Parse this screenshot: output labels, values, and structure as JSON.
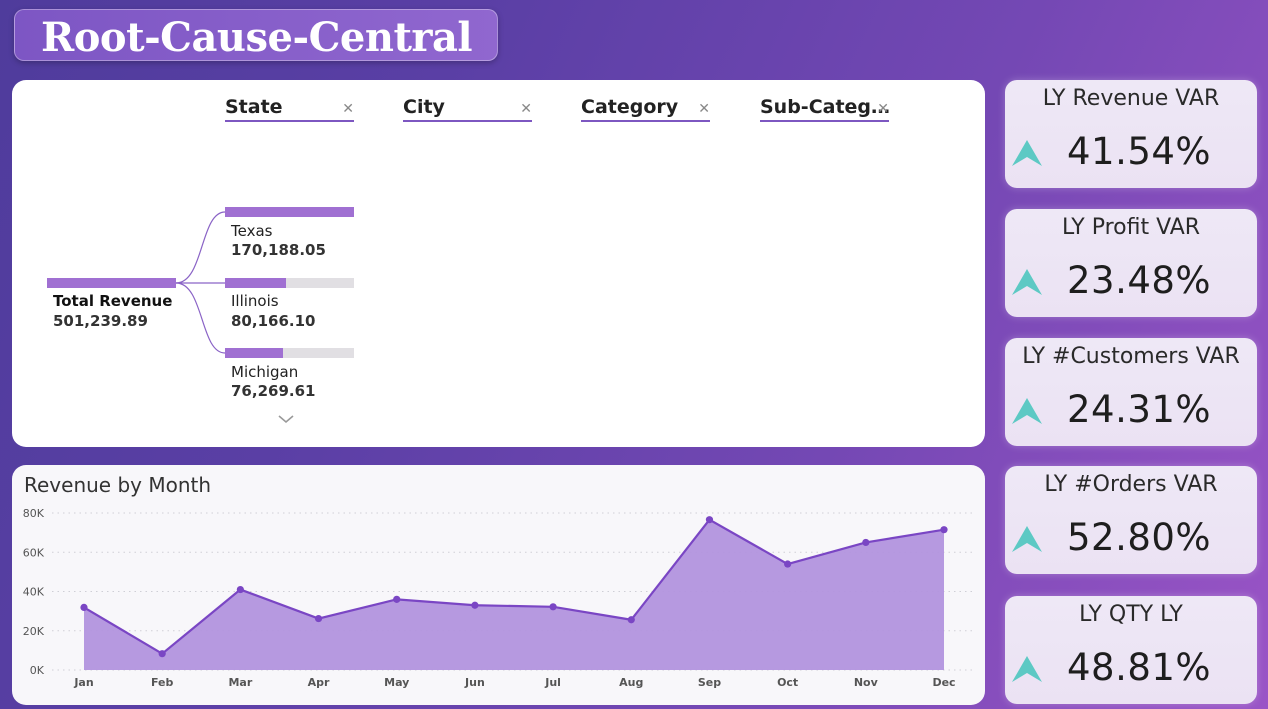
{
  "app_title": "Root-Cause-Central",
  "decomposition": {
    "headers": [
      {
        "label": "State",
        "clear_icon": "close-icon"
      },
      {
        "label": "City",
        "clear_icon": "close-icon"
      },
      {
        "label": "Category",
        "clear_icon": "close-icon"
      },
      {
        "label": "Sub-Categ…",
        "clear_icon": "close-icon"
      }
    ],
    "root": {
      "label": "Total Revenue",
      "value": "501,239.89"
    },
    "nodes": [
      {
        "label": "Texas",
        "value": "170,188.05",
        "fill": 1.0
      },
      {
        "label": "Illinois",
        "value": "80,166.10",
        "fill": 0.47
      },
      {
        "label": "Michigan",
        "value": "76,269.61",
        "fill": 0.45
      }
    ],
    "more_icon": "chevron-down-icon"
  },
  "trend": {
    "title": "Revenue by Month"
  },
  "chart_data": {
    "type": "area",
    "title": "Revenue by Month",
    "xlabel": "",
    "ylabel": "",
    "categories": [
      "Jan",
      "Feb",
      "Mar",
      "Apr",
      "May",
      "Jun",
      "Jul",
      "Aug",
      "Sep",
      "Oct",
      "Nov",
      "Dec"
    ],
    "values": [
      31900,
      8300,
      41000,
      26200,
      36000,
      33000,
      32200,
      25600,
      76600,
      54000,
      65000,
      71500
    ],
    "ylim": [
      0,
      80000
    ],
    "yticks": [
      0,
      20000,
      40000,
      60000,
      80000
    ],
    "ytick_labels": [
      "0K",
      "20K",
      "40K",
      "60K",
      "80K"
    ],
    "grid": true,
    "colors": {
      "line": "#7a46c4",
      "fill": "#b293de",
      "marker": "#7a46c4"
    }
  },
  "kpis": [
    {
      "label": "LY Revenue VAR",
      "value": "41.54%",
      "icon": "arrow-up-icon"
    },
    {
      "label": "LY Profit VAR",
      "value": "23.48%",
      "icon": "arrow-up-icon"
    },
    {
      "label": "LY #Customers VAR",
      "value": "24.31%",
      "icon": "arrow-up-icon"
    },
    {
      "label": "LY #Orders VAR",
      "value": "52.80%",
      "icon": "arrow-up-icon"
    },
    {
      "label": "LY QTY LY",
      "value": "48.81%",
      "icon": "arrow-up-icon"
    }
  ],
  "colors": {
    "accent": "#7d57c1",
    "bar": "#a070d2",
    "arrow": "#5dc9c4"
  }
}
